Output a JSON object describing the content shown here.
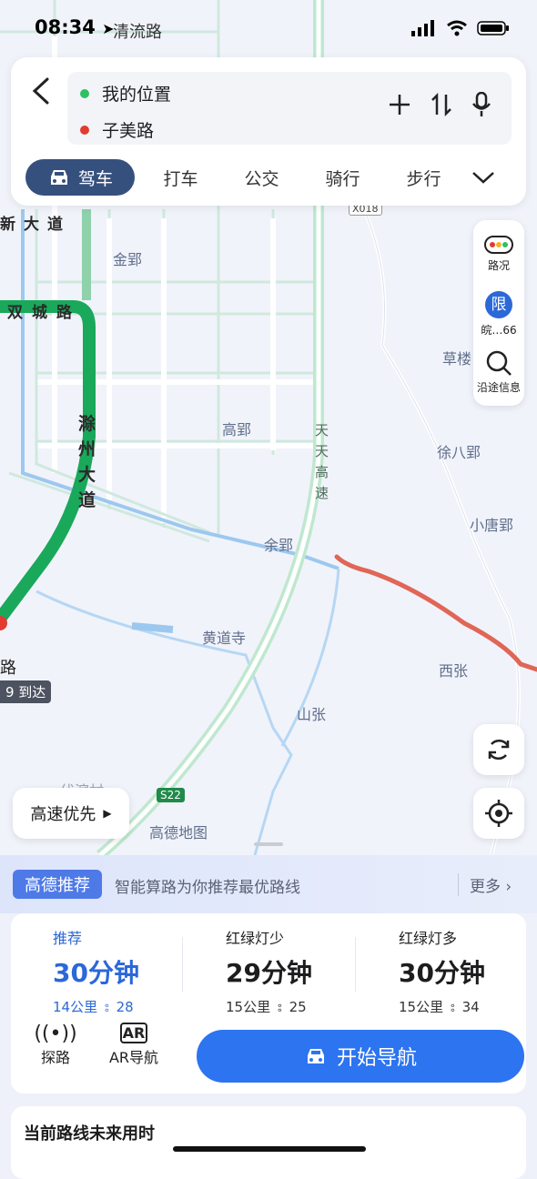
{
  "status_bar": {
    "time": "08:34"
  },
  "map": {
    "place_labels": [
      "清流路",
      "金郢",
      "高郢",
      "余郢",
      "黄道寺",
      "山张",
      "草楼",
      "徐八郢",
      "小唐郢",
      "西张",
      "高德地图",
      "伏滨村"
    ],
    "road_labels": [
      "新大道",
      "双城路",
      "滁州大道",
      "天天高速"
    ],
    "road_codes": [
      "X018",
      "S22"
    ],
    "eta_tag": "9 到达",
    "route_end_label": "路"
  },
  "route_inputs": {
    "origin": "我的位置",
    "destination": "子美路"
  },
  "modes": [
    "驾车",
    "打车",
    "公交",
    "骑行",
    "步行"
  ],
  "right_tools": {
    "traffic": "路况",
    "restriction_badge": "限",
    "restriction_plate": "皖…66",
    "along_route": "沿途信息"
  },
  "preference_button": "高速优先",
  "recommend_bar": {
    "badge": "高德推荐",
    "text": "智能算路为你推荐最优路线",
    "more": "更多"
  },
  "route_options": [
    {
      "label": "推荐",
      "duration": "30分钟",
      "distance": "14公里",
      "lights": "28"
    },
    {
      "label": "红绿灯少",
      "duration": "29分钟",
      "distance": "15公里",
      "lights": "25"
    },
    {
      "label": "红绿灯多",
      "duration": "30分钟",
      "distance": "15公里",
      "lights": "34"
    }
  ],
  "actions": {
    "probe": "探路",
    "ar_nav": "AR导航",
    "start_nav": "开始导航"
  },
  "future_card_title": "当前路线未来用时",
  "colors": {
    "route_green": "#1aa85a",
    "traffic_red": "#e06656",
    "accent_blue": "#2c74f0",
    "mode_active": "#36507e"
  }
}
